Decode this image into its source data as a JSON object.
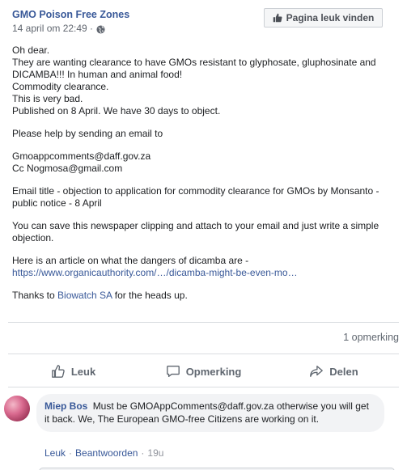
{
  "post": {
    "page_name": "GMO Poison Free Zones",
    "timestamp": "14 april om 22:49 ·",
    "like_page_button": "Pagina leuk vinden",
    "paragraphs": [
      [
        "Oh dear.",
        "They are wanting clearance to have GMOs resistant to glyphosate, gluphosinate and DICAMBA!!! In human and animal food!",
        "Commodity clearance.",
        "This is very bad.",
        "Published on 8 April. We have 30 days to object."
      ],
      [
        "Please help by sending an email to"
      ],
      [
        "Gmoappcomments@daff.gov.za",
        "Cc Nogmosa@gmail.com"
      ],
      [
        "Email title - objection to application for commodity clearance for GMOs by Monsanto - public notice - 8 April"
      ],
      [
        "You can save this newspaper clipping and attach to your email and just write a simple objection."
      ]
    ],
    "article_intro": "Here is an article on what the dangers of dicamba are -",
    "article_link": "https://www.organicauthority.com/…/dicamba-might-be-even-mo…",
    "thanks_prefix": "Thanks to ",
    "thanks_link": "Biowatch SA",
    "thanks_suffix": " for the heads up."
  },
  "stats": {
    "comment_count": "1 opmerking"
  },
  "actions": {
    "like": "Leuk",
    "comment": "Opmerking",
    "share": "Delen"
  },
  "comment": {
    "author": "Miep Bos",
    "text": "Must be GMOAppComments@daff.gov.za otherwise you will get it back. We, The European GMO-free Citizens are working on it.",
    "like": "Leuk",
    "reply": "Beantwoorden",
    "time": "19u"
  },
  "colors": {
    "link": "#385898",
    "meta": "#616770",
    "bubble": "#f2f3f5"
  }
}
